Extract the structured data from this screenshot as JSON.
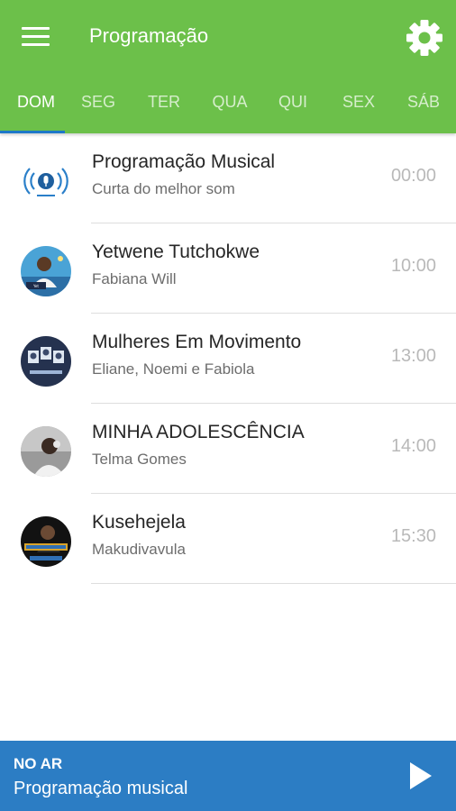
{
  "header": {
    "title": "Programação",
    "menu_icon": "hamburger-menu-icon",
    "settings_icon": "gear-icon",
    "color": "#6cc04a"
  },
  "tabs": [
    {
      "label": "DOM",
      "active": true
    },
    {
      "label": "SEG"
    },
    {
      "label": "TER"
    },
    {
      "label": "QUA"
    },
    {
      "label": "QUI"
    },
    {
      "label": "SEX"
    },
    {
      "label": "SÁB"
    }
  ],
  "schedule": [
    {
      "title": "Programação Musical",
      "host": "Curta do melhor som",
      "time": "00:00"
    },
    {
      "title": "Yetwene Tutchokwe",
      "host": "Fabiana Will",
      "time": "10:00"
    },
    {
      "title": "Mulheres Em Movimento",
      "host": "Eliane, Noemi e Fabiola",
      "time": "13:00"
    },
    {
      "title": "MINHA ADOLESCÊNCIA",
      "host": "Telma Gomes",
      "time": "14:00"
    },
    {
      "title": "Kusehejela",
      "host": "Makudivavula",
      "time": "15:30"
    }
  ],
  "player": {
    "label": "NO AR",
    "now_playing": "Programação musical",
    "play_icon": "play-icon",
    "color": "#2c7dc4"
  }
}
